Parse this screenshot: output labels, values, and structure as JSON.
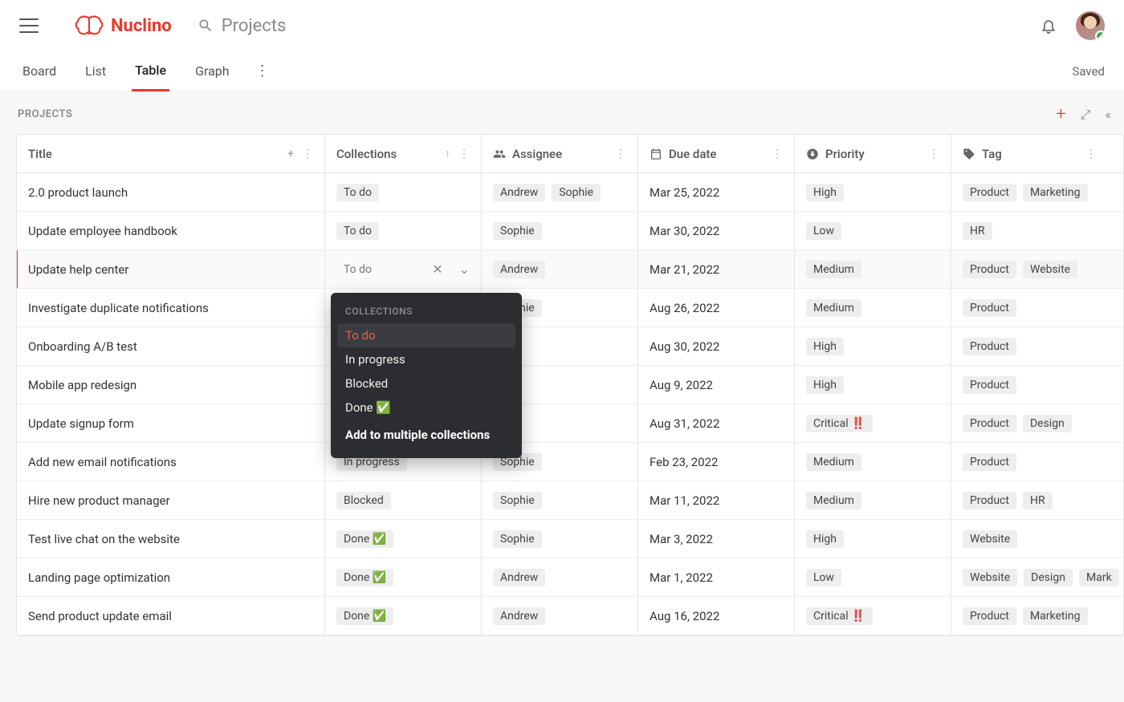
{
  "app": {
    "name": "Nuclino"
  },
  "search": {
    "placeholder": "Projects"
  },
  "status": {
    "saved": "Saved"
  },
  "tabs": {
    "items": [
      "Board",
      "List",
      "Table",
      "Graph"
    ],
    "active": 2
  },
  "section": {
    "title": "PROJECTS"
  },
  "columns": {
    "title": "Title",
    "collections": "Collections",
    "assignee": "Assignee",
    "duedate": "Due date",
    "priority": "Priority",
    "tag": "Tag"
  },
  "rows": [
    {
      "title": "2.0 product launch",
      "collections": [
        "To do"
      ],
      "assignees": [
        "Andrew",
        "Sophie"
      ],
      "duedate": "Mar 25, 2022",
      "priority": "High",
      "tags": [
        "Product",
        "Marketing"
      ]
    },
    {
      "title": "Update employee handbook",
      "collections": [
        "To do"
      ],
      "assignees": [
        "Sophie"
      ],
      "duedate": "Mar 30, 2022",
      "priority": "Low",
      "tags": [
        "HR"
      ]
    },
    {
      "title": "Update help center",
      "collections": [
        "To do"
      ],
      "assignees": [
        "Andrew"
      ],
      "duedate": "Mar 21, 2022",
      "priority": "Medium",
      "tags": [
        "Product",
        "Website"
      ],
      "editing": true
    },
    {
      "title": "Investigate duplicate notifications",
      "collections": [
        ""
      ],
      "assignees": [
        "",
        "Sophie"
      ],
      "duedate": "Aug 26, 2022",
      "priority": "Medium",
      "tags": [
        "Product"
      ]
    },
    {
      "title": "Onboarding A/B test",
      "collections": [
        ""
      ],
      "assignees": [
        ""
      ],
      "duedate": "Aug 30, 2022",
      "priority": "High",
      "tags": [
        "Product"
      ]
    },
    {
      "title": "Mobile app redesign",
      "collections": [
        ""
      ],
      "assignees": [
        ""
      ],
      "duedate": "Aug 9, 2022",
      "priority": "High",
      "tags": [
        "Product"
      ]
    },
    {
      "title": "Update signup form",
      "collections": [
        ""
      ],
      "assignees": [
        ""
      ],
      "duedate": "Aug 31, 2022",
      "priority": "Critical ‼️",
      "tags": [
        "Product",
        "Design"
      ]
    },
    {
      "title": "Add new email notifications",
      "collections": [
        "In progress"
      ],
      "assignees": [
        "",
        "Sophie"
      ],
      "duedate": "Feb 23, 2022",
      "priority": "Medium",
      "tags": [
        "Product"
      ]
    },
    {
      "title": "Hire new product manager",
      "collections": [
        "Blocked"
      ],
      "assignees": [
        "Sophie"
      ],
      "duedate": "Mar 11, 2022",
      "priority": "Medium",
      "tags": [
        "Product",
        "HR"
      ]
    },
    {
      "title": "Test live chat on the website",
      "collections": [
        "Done ✅"
      ],
      "assignees": [
        "Sophie"
      ],
      "duedate": "Mar 3, 2022",
      "priority": "High",
      "tags": [
        "Website"
      ]
    },
    {
      "title": "Landing page optimization",
      "collections": [
        "Done ✅"
      ],
      "assignees": [
        "Andrew"
      ],
      "duedate": "Mar 1, 2022",
      "priority": "Low",
      "tags": [
        "Website",
        "Design",
        "Mark"
      ]
    },
    {
      "title": "Send product update email",
      "collections": [
        "Done ✅"
      ],
      "assignees": [
        "Andrew"
      ],
      "duedate": "Aug 16, 2022",
      "priority": "Critical ‼️",
      "tags": [
        "Product",
        "Marketing"
      ]
    }
  ],
  "dropdown": {
    "header": "COLLECTIONS",
    "items": [
      "To do",
      "In progress",
      "Blocked",
      "Done ✅"
    ],
    "action": "Add to multiple collections",
    "selected": 0
  }
}
